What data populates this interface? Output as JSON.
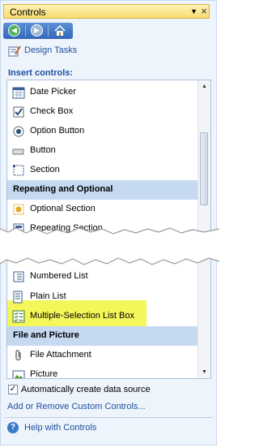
{
  "pane": {
    "title": "Controls",
    "dropdown_icon": "chevron-down-icon",
    "close_icon": "close-icon"
  },
  "nav": {
    "back_icon": "back-arrow-icon",
    "forward_icon": "forward-arrow-icon",
    "home_icon": "home-icon"
  },
  "links": {
    "design_tasks": "Design Tasks",
    "add_remove": "Add or Remove Custom Controls...",
    "help": "Help with Controls"
  },
  "insert_controls_label": "Insert controls:",
  "list": {
    "top_items": [
      {
        "label": "Date Picker",
        "icon": "calendar-icon"
      },
      {
        "label": "Check Box",
        "icon": "checkbox-icon"
      },
      {
        "label": "Option Button",
        "icon": "radio-icon"
      },
      {
        "label": "Button",
        "icon": "button-icon"
      },
      {
        "label": "Section",
        "icon": "section-icon"
      }
    ],
    "categories": [
      {
        "label": "Repeating and Optional"
      },
      {
        "label": "File and Picture"
      }
    ],
    "repeating_items": [
      {
        "label": "Optional Section",
        "icon": "optional-section-icon"
      },
      {
        "label": "Repeating Section",
        "icon": "repeating-section-icon"
      }
    ],
    "partial_item": {
      "label": "Numbered List"
    },
    "bottom_items": [
      {
        "label": "Plain List",
        "icon": "plain-list-icon"
      },
      {
        "label": "Multiple-Selection List Box",
        "icon": "multi-select-list-icon",
        "highlighted": true
      }
    ],
    "file_items": [
      {
        "label": "File Attachment",
        "icon": "paperclip-icon"
      },
      {
        "label": "Picture",
        "icon": "picture-icon"
      }
    ]
  },
  "auto_create": {
    "label": "Automatically create data source",
    "checked": true
  },
  "colors": {
    "highlight": "#f3f75a",
    "category_bg": "#c5d9f1",
    "link": "#1f4fa0"
  }
}
